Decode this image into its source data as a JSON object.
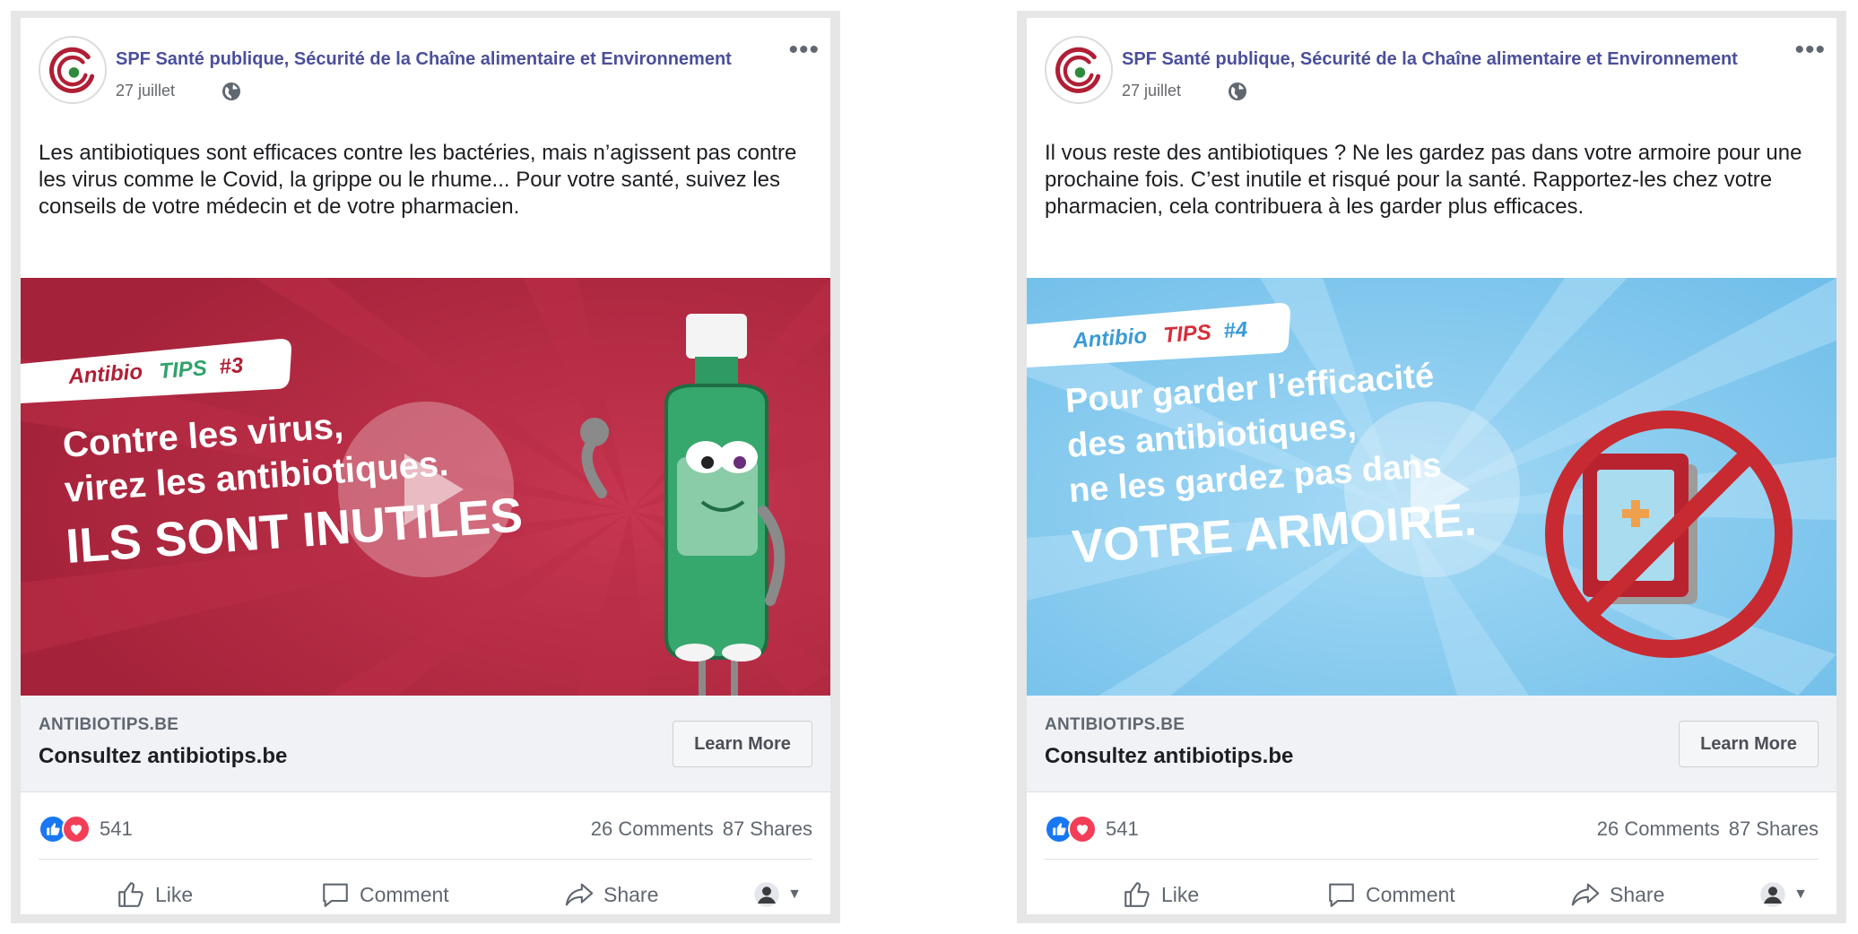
{
  "posts": [
    {
      "page_name": "SPF Santé publique, Sécurité de la Chaîne alimentaire et Environnement",
      "date": "27 juillet",
      "text": "Les antibiotiques sont efficaces contre les bactéries, mais n’agissent pas contre les virus comme le Covid, la grippe ou le rhume... Pour votre santé, suivez les conseils de votre médecin et de votre pharmacien.",
      "media": {
        "tag_prefix": "Antibio",
        "tag_highlight": "TIPS",
        "tag_number": "#3",
        "lines": [
          "Contre les virus,",
          "virez les antibiotiques."
        ],
        "headline": "ILS SONT INUTILES",
        "background_color": "#b32a40",
        "tag_highlight_color": "#2fa36b"
      },
      "link": {
        "domain": "ANTIBIOTIPS.BE",
        "title": "Consultez antibiotips.be",
        "button": "Learn More"
      },
      "reaction_count": "541",
      "comments": "26 Comments",
      "shares": "87 Shares",
      "actions": {
        "like": "Like",
        "comment": "Comment",
        "share": "Share"
      }
    },
    {
      "page_name": "SPF Santé publique, Sécurité de la Chaîne alimentaire et Environnement",
      "date": "27 juillet",
      "text": "Il vous reste des antibiotiques ? Ne les gardez pas dans votre armoire pour une prochaine fois. C’est inutile et risqué pour la santé. Rapportez-les chez votre pharmacien, cela contribuera à les garder plus efficaces.",
      "media": {
        "tag_prefix": "Antibio",
        "tag_highlight": "TIPS",
        "tag_number": "#4",
        "lines": [
          "Pour garder l’efficacité",
          "des antibiotiques,",
          "ne les gardez pas dans"
        ],
        "headline": "VOTRE ARMOIRE.",
        "background_color": "#7cc6ee",
        "tag_highlight_color": "#d62e3b"
      },
      "link": {
        "domain": "ANTIBIOTIPS.BE",
        "title": "Consultez antibiotips.be",
        "button": "Learn More"
      },
      "reaction_count": "541",
      "comments": "26 Comments",
      "shares": "87 Shares",
      "actions": {
        "like": "Like",
        "comment": "Comment",
        "share": "Share"
      }
    }
  ],
  "colors": {
    "page_name": "#4b4f9a",
    "like_blue": "#1877f2",
    "love_red": "#f33e58",
    "link_box": "#f0f2f5"
  }
}
